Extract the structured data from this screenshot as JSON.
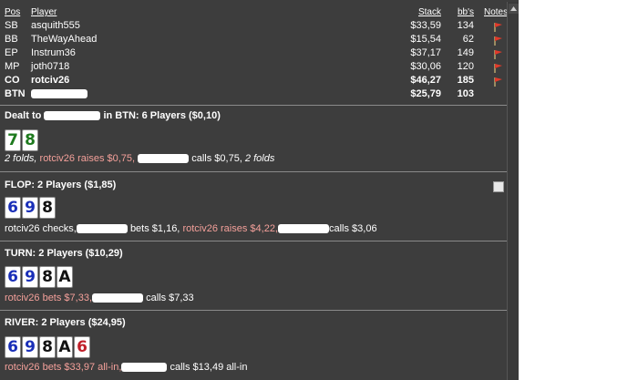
{
  "header": {
    "pos": "Pos",
    "player": "Player",
    "stack": "Stack",
    "bbs": "bb's",
    "notes": "Notes"
  },
  "players": [
    {
      "pos": "SB",
      "name": "asquith555",
      "stack": "$33,59",
      "bbs": "134",
      "flag": true
    },
    {
      "pos": "BB",
      "name": "TheWayAhead",
      "stack": "$15,54",
      "bbs": "62",
      "flag": true
    },
    {
      "pos": "EP",
      "name": "Instrum36",
      "stack": "$37,17",
      "bbs": "149",
      "flag": true
    },
    {
      "pos": "MP",
      "name": "joth0718",
      "stack": "$30,06",
      "bbs": "120",
      "flag": true
    },
    {
      "pos": "CO",
      "name": "rotciv26",
      "stack": "$46,27",
      "bbs": "185",
      "flag": true
    },
    {
      "pos": "BTN",
      "name": "",
      "stack": "$25,79",
      "bbs": "103",
      "flag": false
    }
  ],
  "preflop": {
    "title_a": "Dealt to",
    "title_b": "in BTN: 6 Players ($0,10)",
    "cards": [
      {
        "rank": "7",
        "color": "#1e7a1e"
      },
      {
        "rank": "8",
        "color": "#1e7a1e"
      }
    ],
    "action_a": "2 folds, ",
    "hero_action": "rotciv26 raises $0,75, ",
    "action_b": "calls $0,75, ",
    "action_c": "2 folds"
  },
  "flop": {
    "title": "FLOP: 2 Players ($1,85)",
    "cards": [
      {
        "rank": "6",
        "color": "#1a2fb8"
      },
      {
        "rank": "9",
        "color": "#1a2fb8"
      },
      {
        "rank": "8",
        "color": "#111111"
      }
    ],
    "action_a": "rotciv26 checks,",
    "action_b": "bets $1,16,",
    "hero_action": "rotciv26 raises $4,22,",
    "action_c": "calls $3,06"
  },
  "turn": {
    "title": "TURN: 2 Players ($10,29)",
    "cards": [
      {
        "rank": "6",
        "color": "#1a2fb8"
      },
      {
        "rank": "9",
        "color": "#1a2fb8"
      },
      {
        "rank": "8",
        "color": "#111111"
      },
      {
        "rank": "A",
        "color": "#111111"
      }
    ],
    "hero_action": "rotciv26 bets $7,33,",
    "action_a": "calls $7,33"
  },
  "river": {
    "title": "RIVER: 2 Players ($24,95)",
    "cards": [
      {
        "rank": "6",
        "color": "#1a2fb8"
      },
      {
        "rank": "9",
        "color": "#1a2fb8"
      },
      {
        "rank": "8",
        "color": "#111111"
      },
      {
        "rank": "A",
        "color": "#111111"
      },
      {
        "rank": "6",
        "color": "#c0202a"
      }
    ],
    "hero_action": "rotciv26 bets $33,97 all-in,",
    "action_a": "calls $13,49 all-in"
  }
}
